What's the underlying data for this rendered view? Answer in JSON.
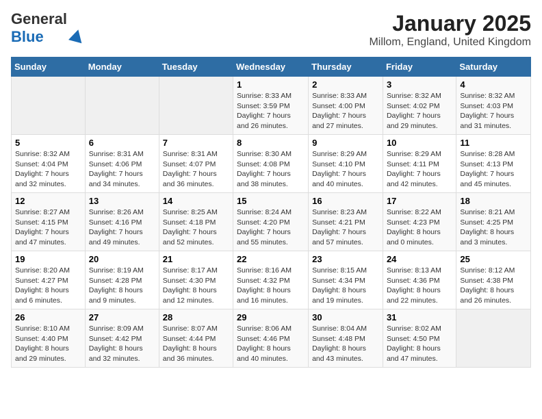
{
  "logo": {
    "general": "General",
    "blue": "Blue"
  },
  "title": "January 2025",
  "subtitle": "Millom, England, United Kingdom",
  "weekdays": [
    "Sunday",
    "Monday",
    "Tuesday",
    "Wednesday",
    "Thursday",
    "Friday",
    "Saturday"
  ],
  "weeks": [
    [
      {
        "day": "",
        "info": ""
      },
      {
        "day": "",
        "info": ""
      },
      {
        "day": "",
        "info": ""
      },
      {
        "day": "1",
        "info": "Sunrise: 8:33 AM\nSunset: 3:59 PM\nDaylight: 7 hours\nand 26 minutes."
      },
      {
        "day": "2",
        "info": "Sunrise: 8:33 AM\nSunset: 4:00 PM\nDaylight: 7 hours\nand 27 minutes."
      },
      {
        "day": "3",
        "info": "Sunrise: 8:32 AM\nSunset: 4:02 PM\nDaylight: 7 hours\nand 29 minutes."
      },
      {
        "day": "4",
        "info": "Sunrise: 8:32 AM\nSunset: 4:03 PM\nDaylight: 7 hours\nand 31 minutes."
      }
    ],
    [
      {
        "day": "5",
        "info": "Sunrise: 8:32 AM\nSunset: 4:04 PM\nDaylight: 7 hours\nand 32 minutes."
      },
      {
        "day": "6",
        "info": "Sunrise: 8:31 AM\nSunset: 4:06 PM\nDaylight: 7 hours\nand 34 minutes."
      },
      {
        "day": "7",
        "info": "Sunrise: 8:31 AM\nSunset: 4:07 PM\nDaylight: 7 hours\nand 36 minutes."
      },
      {
        "day": "8",
        "info": "Sunrise: 8:30 AM\nSunset: 4:08 PM\nDaylight: 7 hours\nand 38 minutes."
      },
      {
        "day": "9",
        "info": "Sunrise: 8:29 AM\nSunset: 4:10 PM\nDaylight: 7 hours\nand 40 minutes."
      },
      {
        "day": "10",
        "info": "Sunrise: 8:29 AM\nSunset: 4:11 PM\nDaylight: 7 hours\nand 42 minutes."
      },
      {
        "day": "11",
        "info": "Sunrise: 8:28 AM\nSunset: 4:13 PM\nDaylight: 7 hours\nand 45 minutes."
      }
    ],
    [
      {
        "day": "12",
        "info": "Sunrise: 8:27 AM\nSunset: 4:15 PM\nDaylight: 7 hours\nand 47 minutes."
      },
      {
        "day": "13",
        "info": "Sunrise: 8:26 AM\nSunset: 4:16 PM\nDaylight: 7 hours\nand 49 minutes."
      },
      {
        "day": "14",
        "info": "Sunrise: 8:25 AM\nSunset: 4:18 PM\nDaylight: 7 hours\nand 52 minutes."
      },
      {
        "day": "15",
        "info": "Sunrise: 8:24 AM\nSunset: 4:20 PM\nDaylight: 7 hours\nand 55 minutes."
      },
      {
        "day": "16",
        "info": "Sunrise: 8:23 AM\nSunset: 4:21 PM\nDaylight: 7 hours\nand 57 minutes."
      },
      {
        "day": "17",
        "info": "Sunrise: 8:22 AM\nSunset: 4:23 PM\nDaylight: 8 hours\nand 0 minutes."
      },
      {
        "day": "18",
        "info": "Sunrise: 8:21 AM\nSunset: 4:25 PM\nDaylight: 8 hours\nand 3 minutes."
      }
    ],
    [
      {
        "day": "19",
        "info": "Sunrise: 8:20 AM\nSunset: 4:27 PM\nDaylight: 8 hours\nand 6 minutes."
      },
      {
        "day": "20",
        "info": "Sunrise: 8:19 AM\nSunset: 4:28 PM\nDaylight: 8 hours\nand 9 minutes."
      },
      {
        "day": "21",
        "info": "Sunrise: 8:17 AM\nSunset: 4:30 PM\nDaylight: 8 hours\nand 12 minutes."
      },
      {
        "day": "22",
        "info": "Sunrise: 8:16 AM\nSunset: 4:32 PM\nDaylight: 8 hours\nand 16 minutes."
      },
      {
        "day": "23",
        "info": "Sunrise: 8:15 AM\nSunset: 4:34 PM\nDaylight: 8 hours\nand 19 minutes."
      },
      {
        "day": "24",
        "info": "Sunrise: 8:13 AM\nSunset: 4:36 PM\nDaylight: 8 hours\nand 22 minutes."
      },
      {
        "day": "25",
        "info": "Sunrise: 8:12 AM\nSunset: 4:38 PM\nDaylight: 8 hours\nand 26 minutes."
      }
    ],
    [
      {
        "day": "26",
        "info": "Sunrise: 8:10 AM\nSunset: 4:40 PM\nDaylight: 8 hours\nand 29 minutes."
      },
      {
        "day": "27",
        "info": "Sunrise: 8:09 AM\nSunset: 4:42 PM\nDaylight: 8 hours\nand 32 minutes."
      },
      {
        "day": "28",
        "info": "Sunrise: 8:07 AM\nSunset: 4:44 PM\nDaylight: 8 hours\nand 36 minutes."
      },
      {
        "day": "29",
        "info": "Sunrise: 8:06 AM\nSunset: 4:46 PM\nDaylight: 8 hours\nand 40 minutes."
      },
      {
        "day": "30",
        "info": "Sunrise: 8:04 AM\nSunset: 4:48 PM\nDaylight: 8 hours\nand 43 minutes."
      },
      {
        "day": "31",
        "info": "Sunrise: 8:02 AM\nSunset: 4:50 PM\nDaylight: 8 hours\nand 47 minutes."
      },
      {
        "day": "",
        "info": ""
      }
    ]
  ]
}
